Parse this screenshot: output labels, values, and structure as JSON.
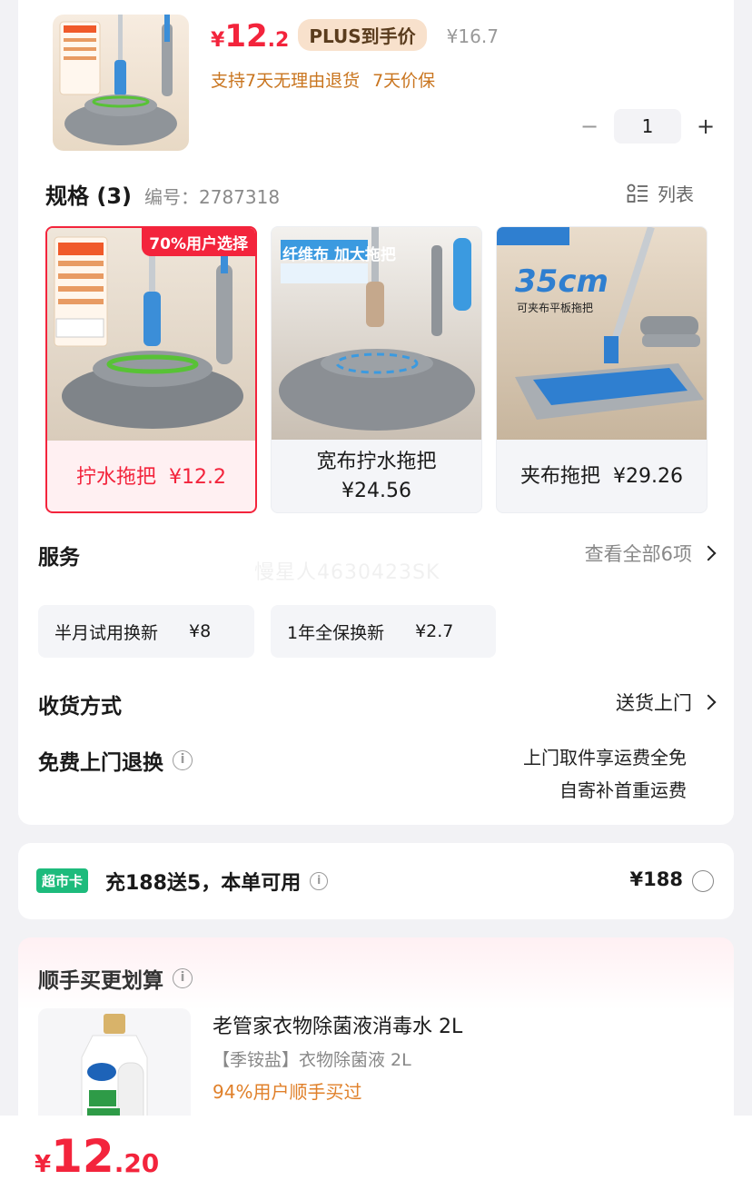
{
  "product": {
    "price_yen": "¥",
    "price_int": "12",
    "price_dec": ".2",
    "plus_tag": "PLUS到手价",
    "original_price": "¥16.7",
    "guarantees": [
      "支持7天无理由退货",
      "7天价保"
    ],
    "quantity": "1",
    "minus": "−",
    "plus": "+"
  },
  "spec": {
    "title": "规格 (3)",
    "code": "编号：2787318",
    "list_label": "列表",
    "variants": [
      {
        "name": "拧水拖把",
        "price": "¥12.2",
        "badge": "70%用户选择",
        "selected": true
      },
      {
        "name": "宽布拧水拖把",
        "price": "¥24.56",
        "img_text": "纤维布 加大拖把"
      },
      {
        "name": "夹布拖把",
        "price": "¥29.26",
        "img_text": "35cm",
        "img_sub": "可夹布平板拖把"
      }
    ]
  },
  "service": {
    "title": "服务",
    "view_all": "查看全部6项",
    "watermark": "慢星人4630423SK",
    "items": [
      {
        "label": "半月试用换新",
        "price": "¥8"
      },
      {
        "label": "1年全保换新",
        "price": "¥2.7"
      }
    ]
  },
  "delivery": {
    "title": "收货方式",
    "value": "送货上门"
  },
  "free_return": {
    "title": "免费上门退换",
    "desc_line1": "上门取件享运费全免",
    "desc_line2": "自寄补首重运费"
  },
  "supermarket": {
    "tag": "超市卡",
    "text": "充188送5，本单可用",
    "price": "¥188"
  },
  "addon": {
    "title": "顺手买更划算",
    "item_name": "老管家衣物除菌液消毒水 2L",
    "item_sub": "【季铵盐】衣物除菌液 2L",
    "item_pct": "94%用户顺手买过"
  },
  "bottom": {
    "yen": "¥",
    "int": "12",
    "dec": ".20"
  },
  "colors": {
    "accent": "#f3243c",
    "gold": "#c9751f",
    "green_tag": "#1dbb7c"
  }
}
